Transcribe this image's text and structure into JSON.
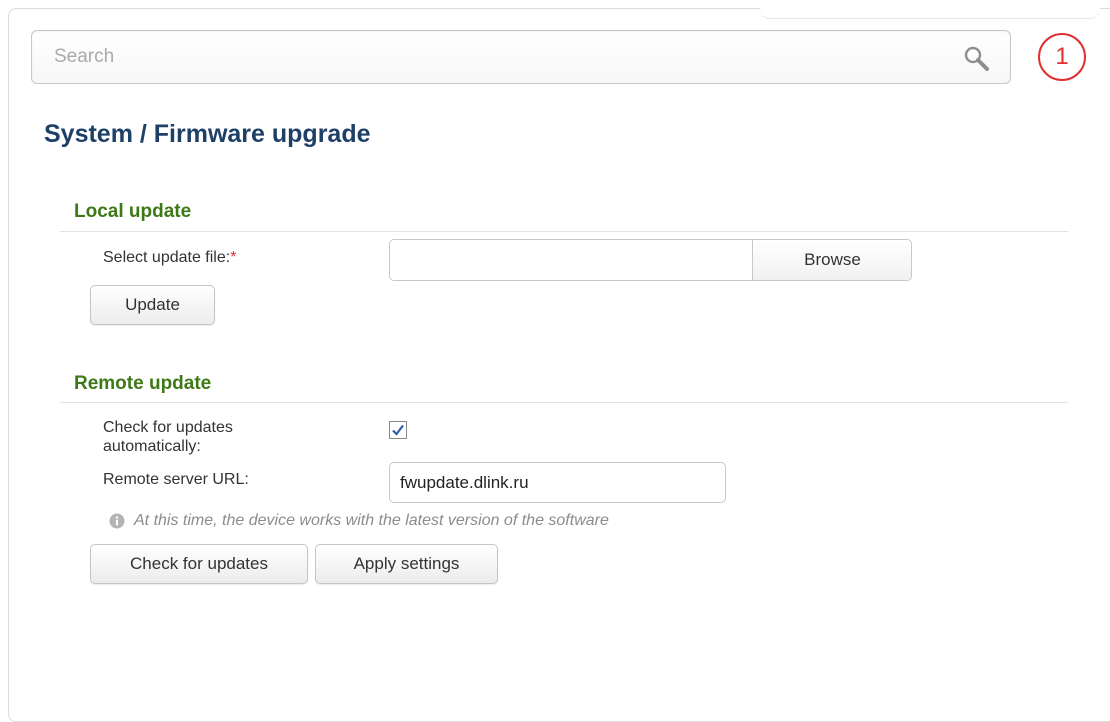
{
  "search": {
    "placeholder": "Search",
    "icon": "search-icon"
  },
  "notifications": {
    "count": "1",
    "color": "#e03030"
  },
  "page": {
    "title": "System /  Firmware upgrade"
  },
  "local_update": {
    "heading": "Local update",
    "file_label": "Select update file:",
    "required_mark": "*",
    "file_value": "",
    "browse_label": "Browse",
    "update_label": "Update"
  },
  "remote_update": {
    "heading": "Remote update",
    "auto_check_label_line1": "Check for updates",
    "auto_check_label_line2": "automatically:",
    "auto_check_checked": true,
    "url_label": "Remote server URL:",
    "url_value": "fwupdate.dlink.ru",
    "info_text": "At this time, the device works with the latest version of the software",
    "check_label": "Check for updates",
    "apply_label": "Apply settings"
  },
  "colors": {
    "title": "#1e3f66",
    "section": "#3d7a17",
    "accent_red": "#e03030"
  }
}
